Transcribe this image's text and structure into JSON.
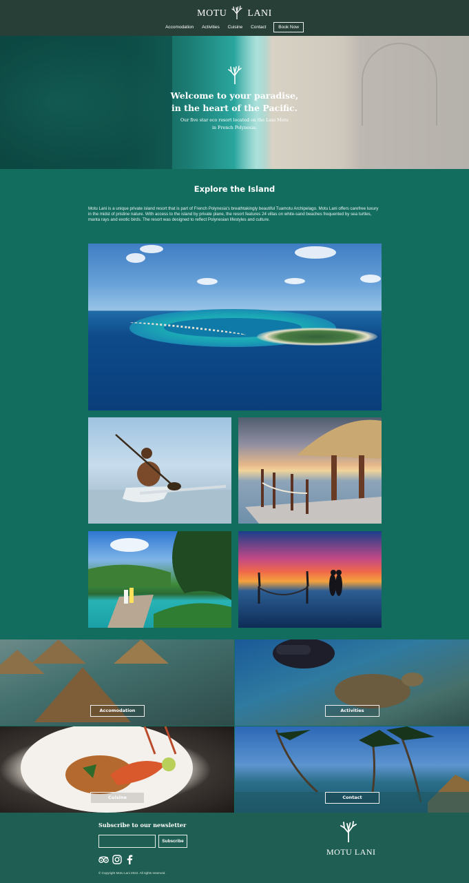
{
  "brand": {
    "left": "MOTU",
    "right": "LANI",
    "footer_name": "MOTU LANI"
  },
  "nav": {
    "items": [
      "Accomodation",
      "Activities",
      "Cuisine",
      "Contact"
    ],
    "book": "Book Now"
  },
  "hero": {
    "title_line1": "Welcome to your paradise,",
    "title_line2": "in the heart of the Pacific.",
    "sub_line1": "Our five star eco resort located on the Lani Motu",
    "sub_line2": "in French Polynesia."
  },
  "explore": {
    "title": "Explore the Island",
    "text": "Motu Lani is a unique private island resort that is part of French Polynesia's breathtakingly beautiful Tuamotu Archipelago. Motu Lani offers carefree luxury in the midst of pristine nature. With access to the island by private plane, the resort features 24 villas on white-sand beaches frequented by sea turtles, manta rays and exotic birds. The resort was designed to reflect Polynesian lifestyles and culture."
  },
  "tiles": [
    "Accomodation",
    "Activities",
    "Cuisine",
    "Contact"
  ],
  "footer": {
    "newsletter_title": "Subscribe to our newsletter",
    "subscribe": "Subscribe",
    "copyright": "© Copyright Motu Lani 2022. All rights reserved."
  },
  "icons": [
    "coral-logo-icon",
    "tripadvisor-icon",
    "instagram-icon",
    "facebook-icon"
  ],
  "colors": {
    "header": "#283f38",
    "main": "#136d5f",
    "footer": "#1f5e52"
  }
}
